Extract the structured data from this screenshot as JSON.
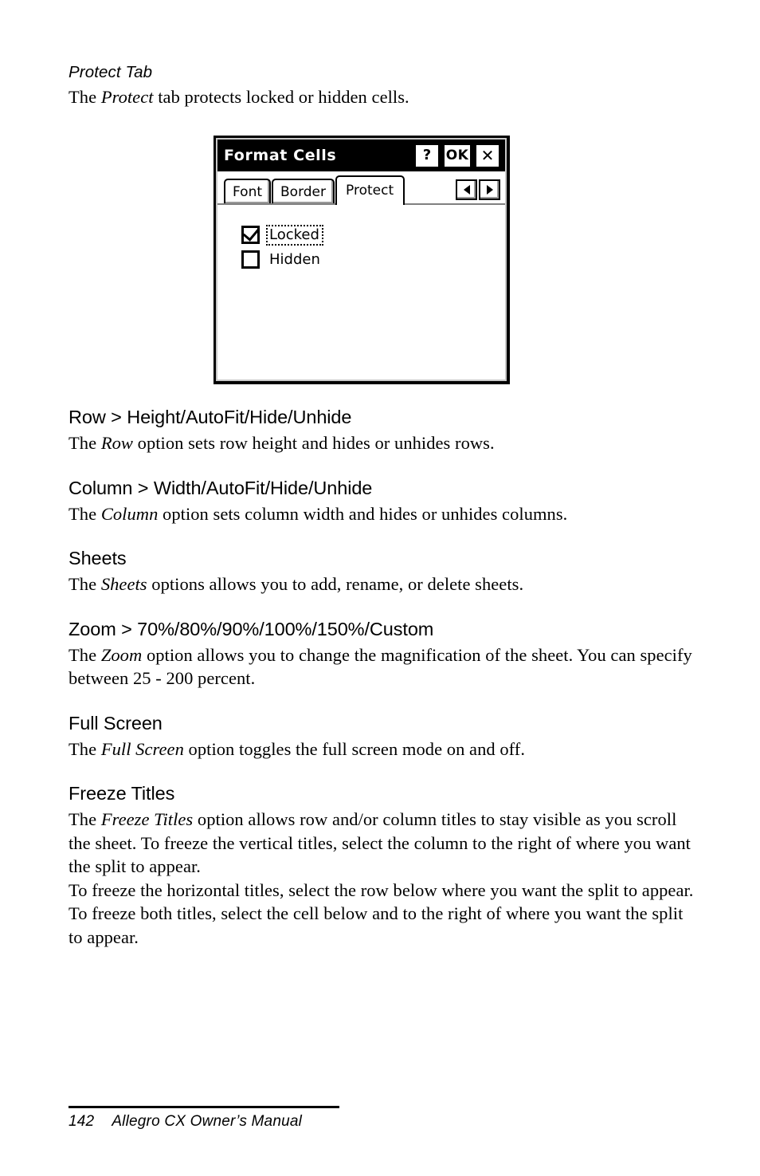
{
  "page": {
    "number": "142",
    "footer_title": "Allegro CX Owner’s Manual"
  },
  "sections": [
    {
      "kind": "sub-head-italic",
      "heading": "Protect Tab",
      "body_prefix": "The ",
      "body_em": "Protect",
      "body_suffix": " tab protects locked or hidden cells."
    },
    {
      "kind": "heading",
      "heading": "Row > Height/AutoFit/Hide/Unhide",
      "body_prefix": "The ",
      "body_em": "Row",
      "body_suffix": " option sets row height and hides or unhides rows."
    },
    {
      "kind": "heading",
      "heading": "Column > Width/AutoFit/Hide/Unhide",
      "body_prefix": "The ",
      "body_em": "Column",
      "body_suffix": " option sets column width and hides or unhides columns."
    },
    {
      "kind": "heading",
      "heading": "Sheets",
      "body_prefix": "The ",
      "body_em": "Sheets",
      "body_suffix": " options allows you to add, rename, or delete sheets."
    },
    {
      "kind": "heading",
      "heading": "Zoom > 70%/80%/90%/100%/150%/Custom",
      "body_prefix": "The ",
      "body_em": "Zoom",
      "body_suffix": " option allows you to change the magnification of the sheet. You can specify between 25 - 200 percent."
    },
    {
      "kind": "heading",
      "heading": "Full Screen",
      "body_prefix": "The ",
      "body_em": "Full Screen",
      "body_suffix": " option toggles the full screen mode on and off."
    },
    {
      "kind": "heading",
      "heading": "Freeze Titles",
      "body_prefix": "The ",
      "body_em": "Freeze Titles",
      "body_suffix": " option allows row and/or column titles to stay visible as you scroll the sheet. To freeze the vertical titles, select the column to the right of where you want the split to appear.",
      "body2": "To freeze the horizontal titles, select the row below where you want the split to appear. To freeze both titles, select the cell below and to the right of where you want the split to appear."
    }
  ],
  "dialog": {
    "title": "Format Cells",
    "titlebar_buttons": [
      {
        "name": "help-button",
        "label": "?"
      },
      {
        "name": "ok-button",
        "label": "OK"
      },
      {
        "name": "close-button",
        "label": "✕"
      }
    ],
    "tabs": [
      {
        "label": "Font",
        "active": false
      },
      {
        "label": "Border",
        "active": false
      },
      {
        "label": "Protect",
        "active": true
      }
    ],
    "tab_scroll": {
      "left_icon": "triangle-left-icon",
      "right_icon": "triangle-right-icon"
    },
    "checkboxes": [
      {
        "label": "Locked",
        "checked": true,
        "focused": true
      },
      {
        "label": "Hidden",
        "checked": false,
        "focused": false
      }
    ]
  }
}
